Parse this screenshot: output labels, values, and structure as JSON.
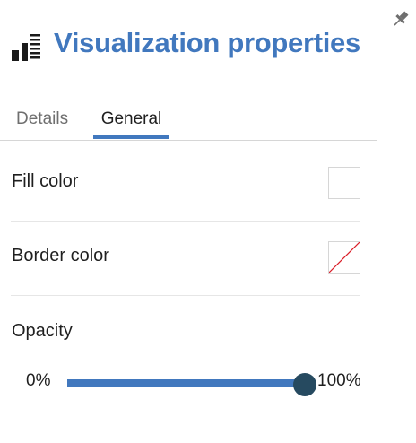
{
  "panel": {
    "title": "Visualization properties",
    "header_icon": "visualization-bars-icon",
    "pin_icon": "pin-icon"
  },
  "tabs": [
    {
      "label": "Details",
      "selected": false
    },
    {
      "label": "General",
      "selected": true
    }
  ],
  "properties": {
    "fill_color": {
      "label": "Fill color",
      "value": "none"
    },
    "border_color": {
      "label": "Border color",
      "value": "none"
    },
    "opacity": {
      "label": "Opacity",
      "min_label": "0%",
      "max_label": "100%",
      "value_percent": 100
    }
  },
  "colors": {
    "accent": "#4178be",
    "thumb": "#264a60",
    "no_color_slash": "#da1e28"
  }
}
